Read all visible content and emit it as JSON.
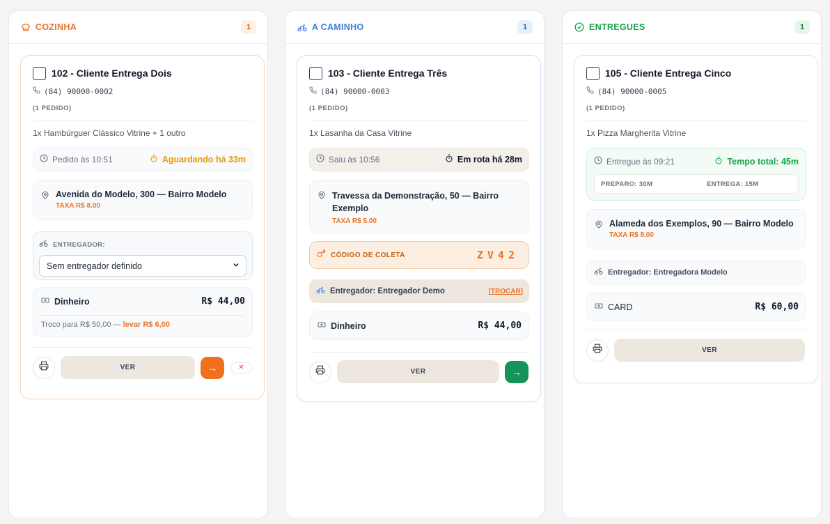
{
  "columns": [
    {
      "title": "COZINHA",
      "count": "1",
      "color": "#ea7424",
      "icon": "chef-hat-icon",
      "card": {
        "name": "102 - Cliente Entrega Dois",
        "phone": "(84) 90000-0002",
        "orders": "(1 PEDIDO)",
        "items": "1x Hambúrguer Clássico Vitrine + 1 outro",
        "time_label": "Pedido às 10:51",
        "status": "Aguardando há 33m",
        "address": "Avenida do Modelo, 300 — Bairro Modelo",
        "fee": "TAXA R$ 8.00",
        "courier_label": "ENTREGADOR:",
        "courier_select": "Sem entregador definido",
        "payment": "Dinheiro",
        "amount": "R$ 44,00",
        "change_text": "Troco para R$ 50,00 —",
        "change_take": "levar R$ 6,00",
        "view": "VER",
        "advance": "→",
        "cancel": "✕"
      }
    },
    {
      "title": "A CAMINHO",
      "count": "1",
      "color": "#3b7fd6",
      "icon": "bicycle-icon",
      "card": {
        "name": "103 - Cliente Entrega Três",
        "phone": "(84) 90000-0003",
        "orders": "(1 PEDIDO)",
        "items": "1x Lasanha da Casa Vitrine",
        "time_label": "Saiu às 10:56",
        "status": "Em rota há 28m",
        "address": "Travessa da Demonstração, 50 — Bairro Exemplo",
        "fee": "TAXA R$ 5.00",
        "pickup_label": "CÓDIGO DE COLETA",
        "pickup_code": "ZV42",
        "courier": "Entregador: Entregador Demo",
        "swap": "[TROCAR]",
        "payment": "Dinheiro",
        "amount": "R$ 44,00",
        "view": "VER",
        "advance": "→"
      }
    },
    {
      "title": "ENTREGUES",
      "count": "1",
      "color": "#16a34a",
      "icon": "check-circle-icon",
      "card": {
        "name": "105 - Cliente Entrega Cinco",
        "phone": "(84) 90000-0005",
        "orders": "(1 PEDIDO)",
        "items": "1x Pizza Margherita Vitrine",
        "time_label": "Entregue às 09:21",
        "status": "Tempo total: 45m",
        "prep": "PREPARO: 30M",
        "delivery": "ENTREGA: 15M",
        "address": "Alameda dos Exemplos, 90 — Bairro Modelo",
        "fee": "TAXA R$ 8.00",
        "courier": "Entregador: Entregadora Modelo",
        "payment": "CARD",
        "amount": "R$ 60,00",
        "view": "VER"
      }
    }
  ]
}
